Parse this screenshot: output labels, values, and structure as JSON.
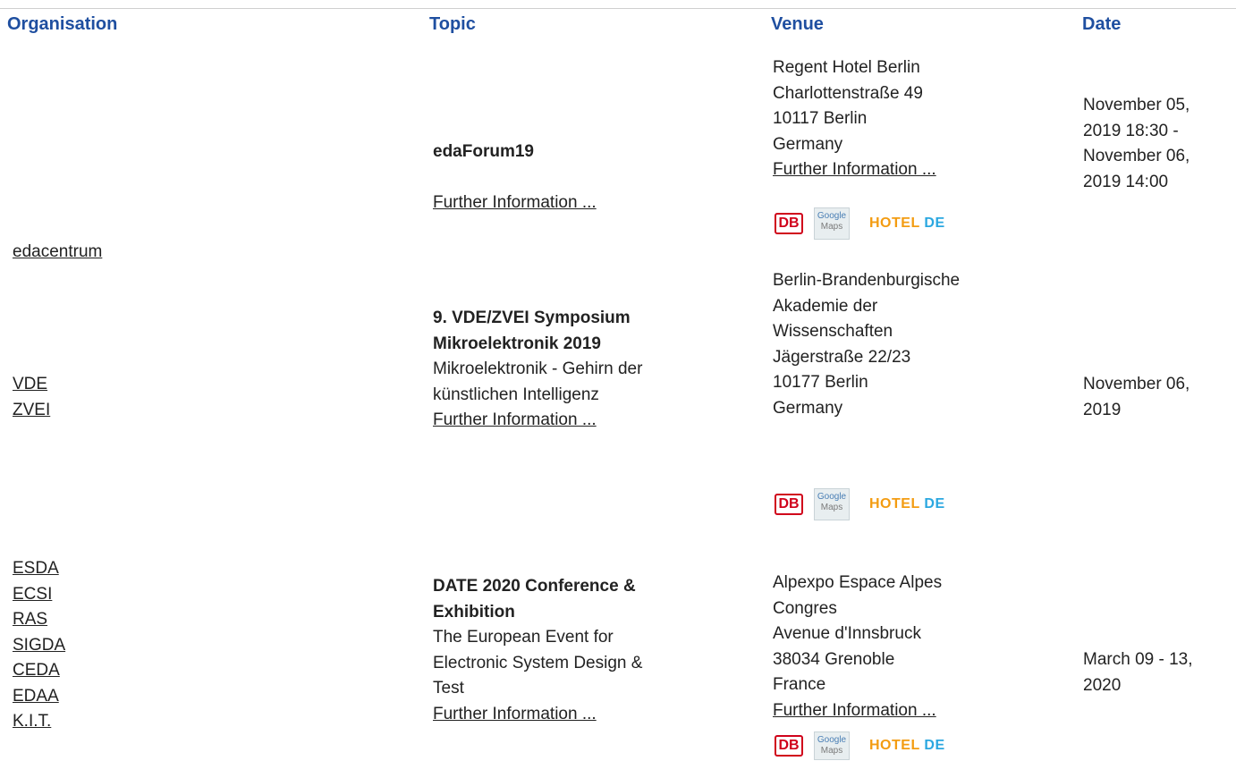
{
  "columns": {
    "organisation": "Organisation",
    "topic": "Topic",
    "venue": "Venue",
    "date": "Date"
  },
  "rows": [
    {
      "organisations": [
        "edacentrum"
      ],
      "topic": {
        "title_lines": [
          "edaForum19"
        ],
        "subtitle_lines": [],
        "link": "Further Information ..."
      },
      "venue": {
        "lines": [
          "Regent Hotel Berlin",
          "Charlottenstraße 49",
          "10117 Berlin",
          "Germany"
        ],
        "link": "Further Information ..."
      },
      "date_lines": [
        "November 05,",
        "2019 18:30 -",
        "November 06,",
        "2019 14:00"
      ]
    },
    {
      "organisations": [
        "VDE",
        "ZVEI"
      ],
      "topic": {
        "title_lines": [
          "9. VDE/ZVEI Symposium",
          "Mikroelektronik 2019"
        ],
        "subtitle_lines": [
          "Mikroelektronik - Gehirn der",
          "künstlichen Intelligenz"
        ],
        "link": "Further Information ..."
      },
      "venue": {
        "lines": [
          "Berlin-Brandenburgische",
          "Akademie der",
          "Wissenschaften",
          "Jägerstraße 22/23",
          "10177 Berlin",
          "Germany"
        ],
        "link": ""
      },
      "date_lines": [
        "November 06,",
        "2019"
      ]
    },
    {
      "organisations": [
        "ESDA",
        "ECSI",
        "RAS",
        "SIGDA",
        "CEDA",
        "EDAA",
        "K.I.T."
      ],
      "topic": {
        "title_lines": [
          "DATE 2020 Conference &",
          "Exhibition"
        ],
        "subtitle_lines": [
          "The European Event for",
          "Electronic System Design &",
          "Test"
        ],
        "link": "Further Information ..."
      },
      "venue": {
        "lines": [
          "Alpexpo Espace Alpes",
          "Congres",
          "Avenue d'Innsbruck",
          "38034 Grenoble",
          "France"
        ],
        "link": "Further Information ..."
      },
      "date_lines": [
        "March 09 - 13,",
        "2020"
      ]
    }
  ],
  "venue_icons": {
    "db": "DB",
    "google_maps": [
      "Google",
      "Maps"
    ],
    "hotel_de": [
      "HOTEL",
      "DE"
    ]
  },
  "colors": {
    "header": "#1f4fa0",
    "db": "#d0021b",
    "hotel": "#f39c12",
    "de": "#2aa7e0"
  }
}
